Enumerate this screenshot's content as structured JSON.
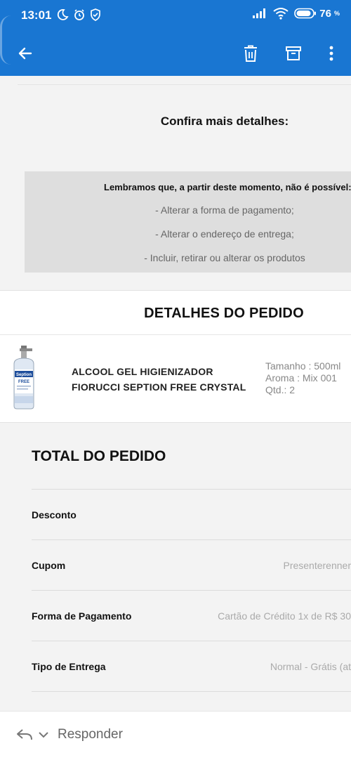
{
  "status_bar": {
    "time": "13:01",
    "battery": "76",
    "battery_unit": "%"
  },
  "toolbar": {
    "back_icon": "arrow-left-icon",
    "delete_icon": "trash-icon",
    "archive_icon": "archive-icon",
    "more_icon": "more-vert-icon"
  },
  "email": {
    "confira": "Confira mais detalhes:",
    "notice": {
      "title": "Lembramos que, a partir deste momento, não é possível:",
      "lines": [
        "- Alterar a forma de pagamento;",
        "- Alterar o endereço de entrega;",
        "- Incluir, retirar ou alterar os produtos"
      ]
    },
    "details_title": "DETALHES DO PEDIDO",
    "product": {
      "name_line1": "ALCOOL GEL HIGIENIZADOR",
      "name_line2": "FIORUCCI SEPTION FREE CRYSTAL",
      "spec_size": "Tamanho : 500ml",
      "spec_aroma": "Aroma : Mix 001",
      "spec_qty": "Qtd.: 2",
      "image_brand": "Seption",
      "image_sub": "FREE"
    },
    "total_title": "TOTAL DO PEDIDO",
    "rows": [
      {
        "label": "Desconto",
        "value": ""
      },
      {
        "label": "Cupom",
        "value": "Presenterenner"
      },
      {
        "label": "Forma de Pagamento",
        "value": "Cartão de Crédito 1x de R$ 30"
      },
      {
        "label": "Tipo de Entrega",
        "value": "Normal - Grátis (at"
      }
    ]
  },
  "reply_bar": {
    "reply_label": "Responder"
  },
  "colors": {
    "app_bar": "#1976d2",
    "content_bg": "#f3f3f3",
    "notice_bg": "#dedede"
  }
}
